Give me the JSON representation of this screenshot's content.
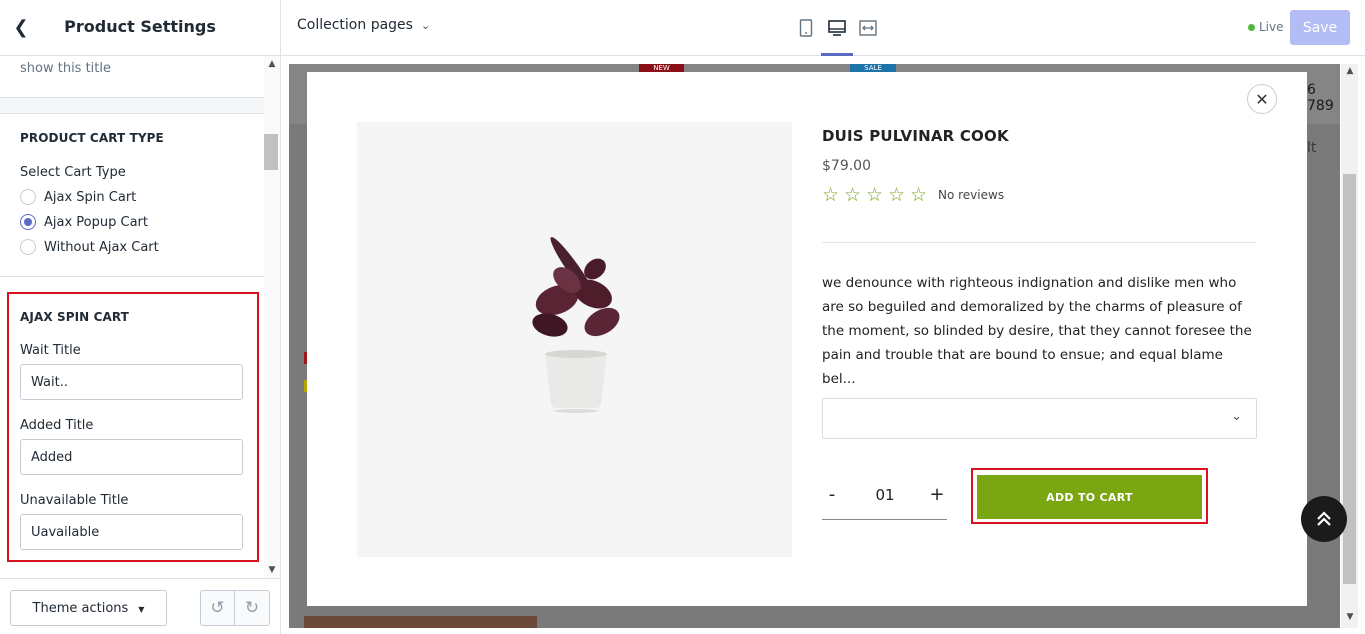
{
  "sidebar": {
    "title": "Product Settings",
    "cut_text": "show this title",
    "cart_type": {
      "heading": "PRODUCT CART TYPE",
      "label": "Select Cart Type",
      "options": [
        "Ajax Spin Cart",
        "Ajax Popup Cart",
        "Without Ajax Cart"
      ],
      "selected": "Ajax Popup Cart"
    },
    "ajax_spin": {
      "heading": "AJAX SPIN CART",
      "wait_label": "Wait Title",
      "wait_value": "Wait..",
      "added_label": "Added Title",
      "added_value": "Added",
      "unavailable_label": "Unavailable Title",
      "unavailable_value": "Uavailable"
    },
    "footer": {
      "theme_actions": "Theme actions"
    }
  },
  "topbar": {
    "page_select": "Collection pages",
    "status": "Live",
    "save": "Save"
  },
  "background": {
    "badge_new": "NEW",
    "badge_sale": "SALE",
    "phone_fragment": "6 789",
    "side_fragment": "lt"
  },
  "modal": {
    "title": "DUIS PULVINAR COOK",
    "price": "$79.00",
    "rating_stars": 0,
    "reviews": "No reviews",
    "description": "we denounce with righteous indignation and dislike men who are so beguiled and demoralized by the charms of pleasure of the moment, so blinded by desire, that they cannot foresee the pain and trouble that are bound to ensue; and equal blame bel...",
    "quantity": "01",
    "add_to_cart": "ADD TO CART"
  },
  "colors": {
    "accent": "#5c6ac4",
    "cart_green": "#7aa612",
    "highlight_red": "#d9121d"
  }
}
